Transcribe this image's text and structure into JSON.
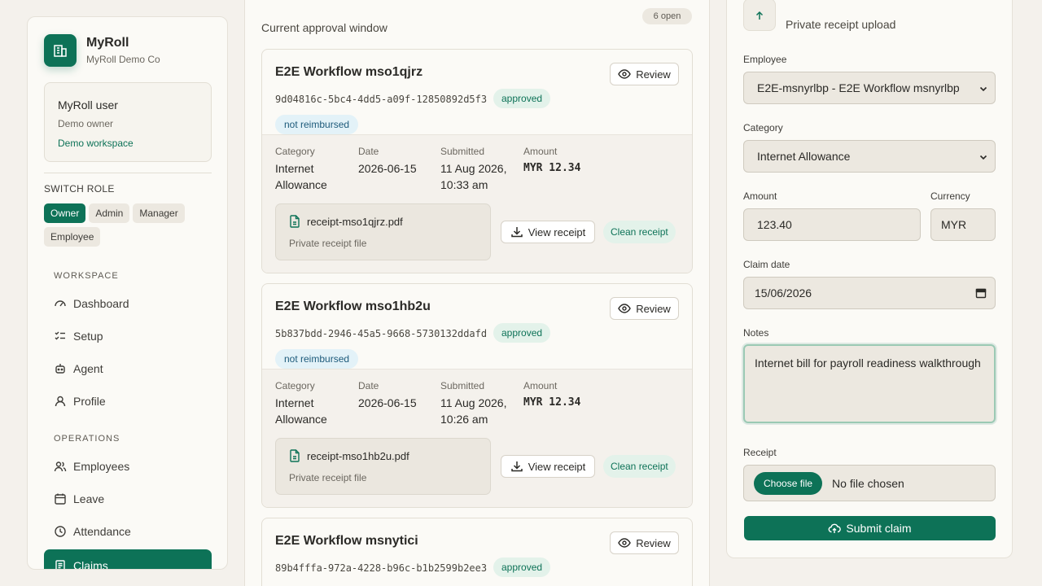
{
  "brand": {
    "name": "MyRoll",
    "company": "MyRoll Demo Co"
  },
  "user": {
    "name": "MyRoll user",
    "role": "Demo owner",
    "workspace": "Demo workspace"
  },
  "switch_role": {
    "label": "SWITCH ROLE",
    "roles": [
      "Owner",
      "Admin",
      "Manager",
      "Employee"
    ],
    "active": "Owner"
  },
  "nav": {
    "workspace_label": "WORKSPACE",
    "workspace_items": [
      {
        "label": "Dashboard",
        "icon": "gauge-icon"
      },
      {
        "label": "Setup",
        "icon": "checklist-icon"
      },
      {
        "label": "Agent",
        "icon": "bot-icon"
      },
      {
        "label": "Profile",
        "icon": "user-icon"
      }
    ],
    "operations_label": "OPERATIONS",
    "operations_items": [
      {
        "label": "Employees",
        "icon": "users-icon"
      },
      {
        "label": "Leave",
        "icon": "calendar-icon"
      },
      {
        "label": "Attendance",
        "icon": "clock-icon"
      },
      {
        "label": "Claims",
        "icon": "receipt-icon",
        "active": true
      }
    ]
  },
  "queue": {
    "subtitle": "Current approval window",
    "open_count": "6 open",
    "labels": {
      "category": "Category",
      "date": "Date",
      "submitted": "Submitted",
      "amount": "Amount",
      "review": "Review",
      "view_receipt": "View receipt",
      "private_file": "Private receipt file"
    },
    "claims": [
      {
        "title": "E2E Workflow mso1qjrz",
        "id": "9d04816c-5bc4-4dd5-a09f-12850892d5f3",
        "status": "approved",
        "reimbursement": "not reimbursed",
        "category_line1": "Internet",
        "category_line2": "Allowance",
        "date": "2026-06-15",
        "submitted_line1": "11 Aug 2026,",
        "submitted_line2": "10:33 am",
        "amount": "MYR 12.34",
        "file": "receipt-mso1qjrz.pdf",
        "receipt_check": "Clean receipt"
      },
      {
        "title": "E2E Workflow mso1hb2u",
        "id": "5b837bdd-2946-45a5-9668-5730132ddafd",
        "status": "approved",
        "reimbursement": "not reimbursed",
        "category_line1": "Internet",
        "category_line2": "Allowance",
        "date": "2026-06-15",
        "submitted_line1": "11 Aug 2026,",
        "submitted_line2": "10:26 am",
        "amount": "MYR 12.34",
        "file": "receipt-mso1hb2u.pdf",
        "receipt_check": "Clean receipt"
      },
      {
        "title": "E2E Workflow msnytici",
        "id": "89b4fffa-972a-4228-b96c-b1b2599b2ee3",
        "status": "approved"
      }
    ]
  },
  "form": {
    "upload_label": "Private receipt upload",
    "employee_label": "Employee",
    "employee_value": "E2E-msnyrlbp - E2E Workflow msnyrlbp",
    "category_label": "Category",
    "category_value": "Internet Allowance",
    "amount_label": "Amount",
    "amount_value": "123.40",
    "currency_label": "Currency",
    "currency_value": "MYR",
    "claim_date_label": "Claim date",
    "claim_date_value": "15/06/2026",
    "notes_label": "Notes",
    "notes_value": "Internet bill for payroll readiness walkthrough",
    "receipt_label": "Receipt",
    "choose_file": "Choose file",
    "no_file": "No file chosen",
    "submit": "Submit claim"
  },
  "colors": {
    "accent": "#0d7257",
    "background": "#f4f1ec"
  }
}
